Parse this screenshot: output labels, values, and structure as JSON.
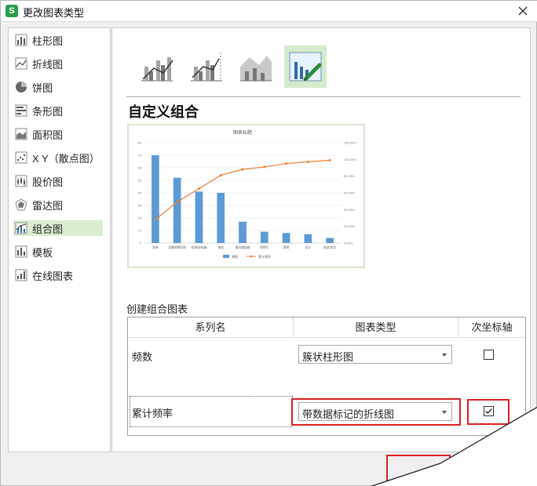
{
  "window": {
    "title": "更改图表类型",
    "app_icon_label": "S"
  },
  "sidebar": {
    "items": [
      {
        "label": "柱形图"
      },
      {
        "label": "折线图"
      },
      {
        "label": "饼图"
      },
      {
        "label": "条形图"
      },
      {
        "label": "面积图"
      },
      {
        "label": "X Y（散点图）"
      },
      {
        "label": "股价图"
      },
      {
        "label": "雷达图"
      },
      {
        "label": "组合图",
        "selected": true
      },
      {
        "label": "模板"
      },
      {
        "label": "在线图表"
      }
    ]
  },
  "main": {
    "subtype_icons": [
      "clustered-column-line-icon",
      "clustered-column-line-secondary-icon",
      "stacked-area-column-icon",
      "custom-combo-icon"
    ],
    "section_title": "自定义组合",
    "preview_chart": {
      "chart_data": {
        "type": "bar",
        "title": "图表标题",
        "categories": [
          "拆装",
          "设备故障导致",
          "电源/配电箱",
          "电缆",
          "通讯器插座",
          "照明灯",
          "照明",
          "设计",
          "其他/其它"
        ],
        "series": [
          {
            "name": "频数",
            "type": "bar",
            "axis": "primary",
            "values": [
              70,
              52,
              41,
              40,
              17,
              9,
              8,
              7,
              4
            ]
          },
          {
            "name": "累计频率",
            "type": "line",
            "axis": "secondary",
            "values": [
              0.28,
              0.49,
              0.65,
              0.81,
              0.88,
              0.91,
              0.95,
              0.97,
              0.99
            ]
          }
        ],
        "ylim": [
          0,
          80
        ],
        "y_ticks": [
          "80",
          "70",
          "60",
          "50",
          "40",
          "30",
          "20",
          "10",
          "0"
        ],
        "y2lim": [
          0,
          1.2
        ],
        "y2_ticks": [
          "120.00%",
          "100.00%",
          "80.00%",
          "60.00%",
          "40.00%",
          "20.00%",
          "0.00%"
        ],
        "legend_placement": "bottom",
        "colors": {
          "bar": "#5b9bd5",
          "line": "#ed7d31"
        }
      }
    },
    "combo_section_label": "创建组合图表",
    "table": {
      "headers": [
        "系列名",
        "图表类型",
        "次坐标轴"
      ],
      "rows": [
        {
          "series_name": "频数",
          "chart_type": "簇状柱形图",
          "secondary_axis": false
        },
        {
          "series_name": "累计频率",
          "chart_type": "带数据标记的折线图",
          "secondary_axis": true
        }
      ]
    }
  },
  "colors": {
    "accent_green": "#dbedd0",
    "highlight_red": "#e02020"
  }
}
